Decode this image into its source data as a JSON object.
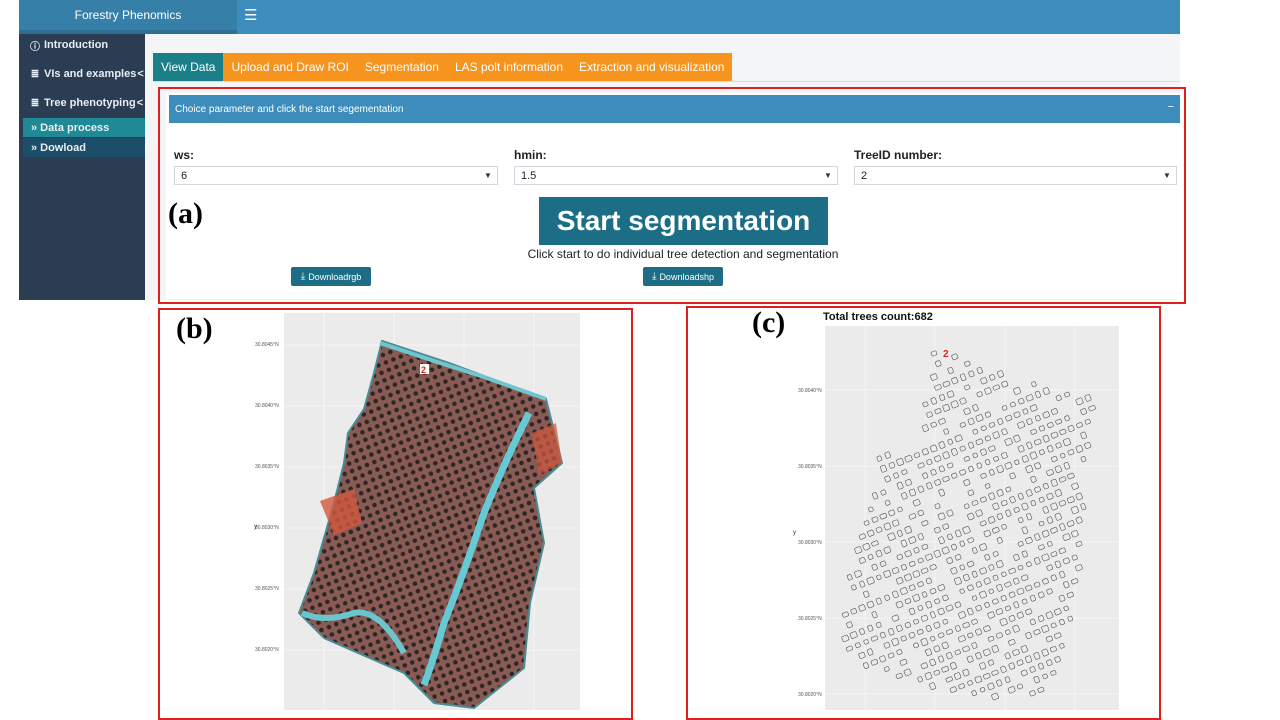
{
  "app": {
    "title": "Forestry Phenomics"
  },
  "sidebar": {
    "items": [
      {
        "label": "Introduction",
        "icon": "info-circle-icon"
      },
      {
        "label": "VIs and examples",
        "icon": "database-icon",
        "chevron": "<"
      },
      {
        "label": "Tree phenotyping",
        "icon": "database-icon",
        "chevron": "<"
      }
    ],
    "subitems": [
      {
        "label": "Data process",
        "icon": "double-chevron-right-icon",
        "active": true
      },
      {
        "label": "Dowload",
        "icon": "double-chevron-right-icon",
        "active": false
      }
    ]
  },
  "tabs": [
    {
      "label": "View Data",
      "active": true
    },
    {
      "label": "Upload and Draw ROI"
    },
    {
      "label": "Segmentation"
    },
    {
      "label": "LAS polt information"
    },
    {
      "label": "Extraction and visualization"
    }
  ],
  "panel": {
    "title": "Choice parameter and click the start segementation",
    "collapse": "−",
    "params": [
      {
        "label": "ws:",
        "value": "6"
      },
      {
        "label": "hmin:",
        "value": "1.5"
      },
      {
        "label": "TreeID number:",
        "value": "2"
      }
    ],
    "start_button": "Start segmentation",
    "start_hint": "Click start to do individual tree detection and segmentation",
    "download_rgb": "Downloadrgb",
    "download_shp": "Downloadshp"
  },
  "figure_labels": {
    "a": "(a)",
    "b": "(b)",
    "c": "(c)"
  },
  "plot_b": {
    "y_ticks": [
      "30.8045°N",
      "30.8040°N",
      "30.8035°N",
      "30.8030°N",
      "30.8025°N",
      "30.8020°N"
    ],
    "y_label": "y",
    "marker": "2"
  },
  "plot_c": {
    "title": "Total trees count:682",
    "y_ticks": [
      "30.8040°N",
      "30.8035°N",
      "30.8030°N",
      "30.8025°N",
      "30.8020°N"
    ],
    "y_label": "y",
    "marker": "2"
  },
  "colors": {
    "header_blue": "#3c8dbc",
    "sidebar_dark": "#2a3d52",
    "active_teal": "#1b7f8a",
    "tab_orange": "#f7941d",
    "frame_red": "#e21f1f"
  }
}
